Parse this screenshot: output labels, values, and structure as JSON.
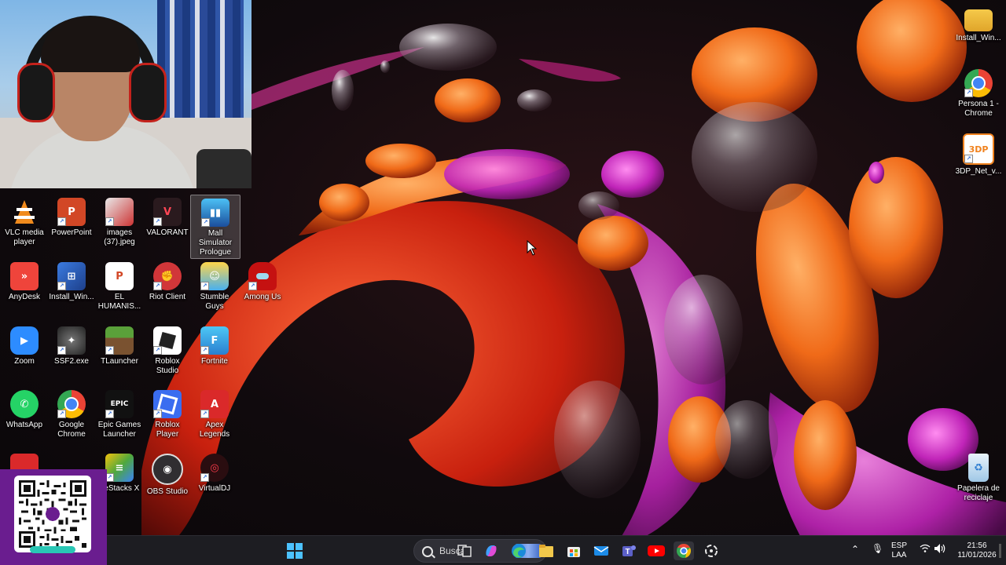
{
  "desktop": {
    "icons_left": [
      {
        "id": "vlc",
        "label": "VLC media player",
        "color": "#f08a1d"
      },
      {
        "id": "powerpoint",
        "label": "PowerPoint",
        "color": "#d24726"
      },
      {
        "id": "images",
        "label": "images (37).jpeg",
        "color": "#c8c8c8"
      },
      {
        "id": "valorant",
        "label": "VALORANT",
        "color": "#ff4655"
      },
      {
        "id": "mall",
        "label": "Mall Simulator Prologue",
        "color": "#2d8fd6"
      },
      {
        "id": "anydesk",
        "label": "AnyDesk",
        "color": "#ef443b"
      },
      {
        "id": "install",
        "label": "Install_Win...",
        "color": "#2f6fd1"
      },
      {
        "id": "el-humanis",
        "label": "EL HUMANIS...",
        "color": "#d24726"
      },
      {
        "id": "riot",
        "label": "Riot Client",
        "color": "#d13639"
      },
      {
        "id": "stumble",
        "label": "Stumble Guys",
        "color": "#47b0f0"
      },
      {
        "id": "amongus",
        "label": "Among Us",
        "color": "#c51111"
      },
      {
        "id": "zoom",
        "label": "Zoom",
        "color": "#2d8cff"
      },
      {
        "id": "ssf2",
        "label": "SSF2.exe",
        "color": "#444444"
      },
      {
        "id": "tlauncher",
        "label": "TLauncher",
        "color": "#3e8e2c"
      },
      {
        "id": "roblox-studio",
        "label": "Roblox Studio",
        "color": "#2b2b2b"
      },
      {
        "id": "fortnite",
        "label": "Fortnite",
        "color": "#2fa9e8"
      },
      {
        "id": "whatsapp",
        "label": "WhatsApp",
        "color": "#25d366"
      },
      {
        "id": "chrome",
        "label": "Google Chrome",
        "color": "#4285f4"
      },
      {
        "id": "epic",
        "label": "Epic Games Launcher",
        "color": "#111111"
      },
      {
        "id": "roblox-player",
        "label": "Roblox Player",
        "color": "#3a6df0"
      },
      {
        "id": "apex",
        "label": "Apex Legends",
        "color": "#da292a"
      },
      {
        "id": "bluestacks",
        "label": "ueStacks X",
        "color": "#4fa83d"
      },
      {
        "id": "obs",
        "label": "OBS Studio",
        "color": "#302e31"
      },
      {
        "id": "virtualdj",
        "label": "VirtualDJ",
        "color": "#c41e2b"
      }
    ],
    "icons_right": [
      {
        "id": "install-right",
        "label": "Install_Win...",
        "color": "#e8b43a"
      },
      {
        "id": "chrome-persona",
        "label": "Persona 1 - Chrome",
        "color": "#4285f4"
      },
      {
        "id": "3dp",
        "label": "3DP_Net_v...",
        "color": "#f0821e"
      },
      {
        "id": "recycle",
        "label": "Papelera de reciclaje",
        "color": "#9fc7e6"
      }
    ]
  },
  "taskbar": {
    "search_placeholder": "Buscar",
    "apps": [
      "windows-start",
      "task-view",
      "copilot",
      "edge",
      "file-explorer",
      "store",
      "mail",
      "teams",
      "youtube",
      "chrome",
      "chatgpt"
    ],
    "tray": {
      "language_top": "ESP",
      "language_bottom": "LAA",
      "time": "21:56",
      "date": "11/01/2026"
    }
  },
  "colors": {
    "taskbar_bg": "#1d1d22",
    "qr_panel": "#6a1d8f",
    "qr_tag": "#29c7b5"
  }
}
